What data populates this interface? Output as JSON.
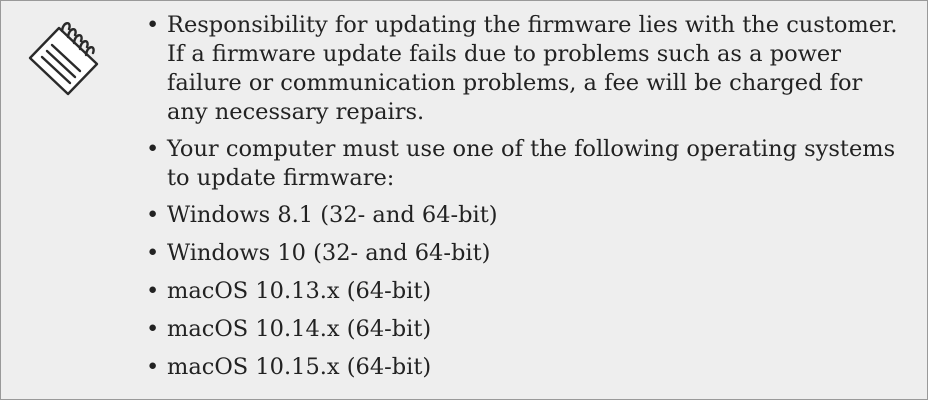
{
  "note": {
    "icon": "notepad-icon",
    "items": [
      "Responsibility for updating the firmware lies with the customer. If a firmware update fails due to problems such as a power failure or communication problems, a fee will be charged for any necessary repairs.",
      "Your computer must use one of the following operating systems to update firmware:"
    ],
    "os_list": [
      "Windows 8.1 (32- and 64-bit)",
      "Windows 10 (32- and 64-bit)",
      "macOS 10.13.x (64-bit)",
      "macOS 10.14.x (64-bit)",
      "macOS 10.15.x (64-bit)"
    ]
  }
}
